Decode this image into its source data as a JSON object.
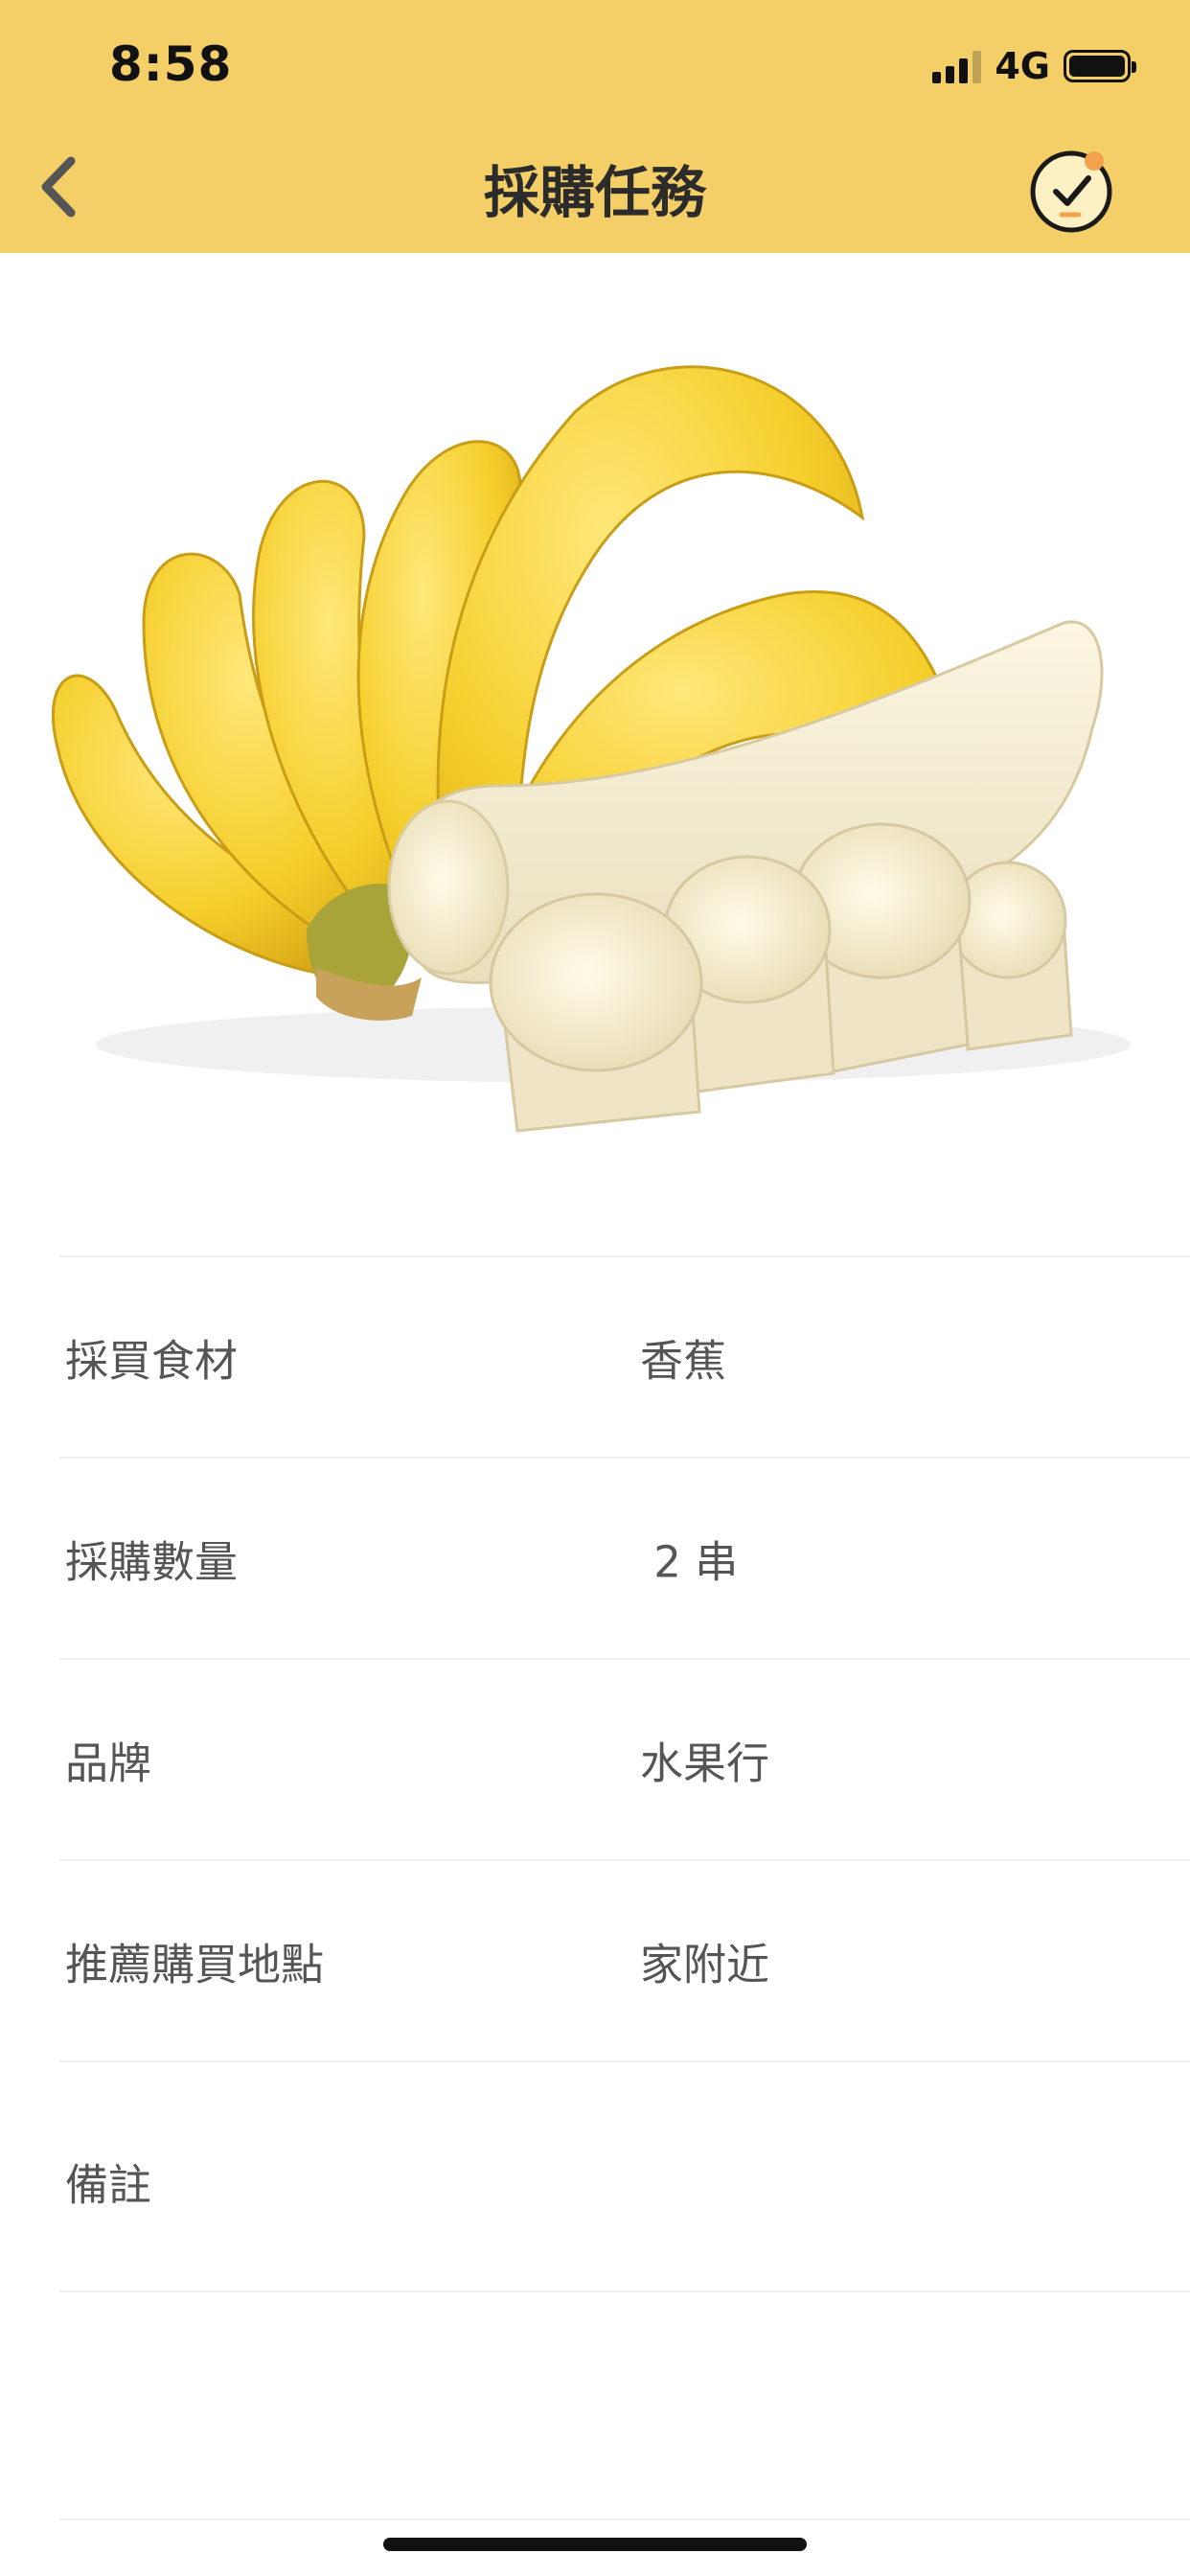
{
  "status_bar": {
    "time": "8:58",
    "network": "4G"
  },
  "header": {
    "title": "採購任務",
    "back_icon": "chevron-left-icon",
    "done_icon": "clock-check-icon"
  },
  "hero": {
    "image": "banana-bunch-and-slices"
  },
  "details": {
    "ingredient": {
      "label": "採買食材",
      "value": "香蕉"
    },
    "quantity": {
      "label": "採購數量",
      "value": " 2 串"
    },
    "brand": {
      "label": "品牌",
      "value": "水果行"
    },
    "location": {
      "label": "推薦購買地點",
      "value": "家附近"
    },
    "note": {
      "label": "備註",
      "value": ""
    }
  },
  "colors": {
    "header_bg": "#f4cf67",
    "accent_orange": "#f2a24d"
  }
}
